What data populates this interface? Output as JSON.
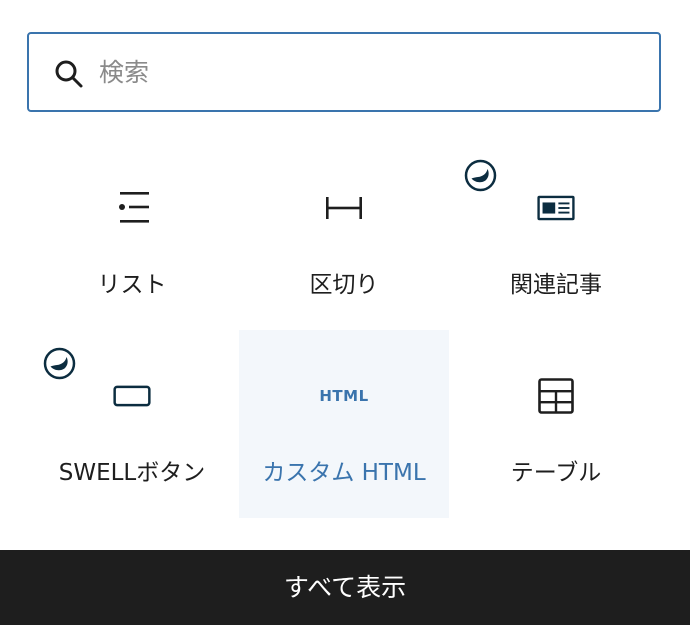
{
  "search": {
    "placeholder": "検索",
    "value": ""
  },
  "blocks": [
    {
      "label": "リスト",
      "icon": "list-icon",
      "badge": false,
      "active": false
    },
    {
      "label": "区切り",
      "icon": "separator-icon",
      "badge": false,
      "active": false
    },
    {
      "label": "関連記事",
      "icon": "post-card-icon",
      "badge": true,
      "active": false
    },
    {
      "label": "SWELLボタン",
      "icon": "button-icon",
      "badge": true,
      "active": false
    },
    {
      "label": "カスタム HTML",
      "icon": "html-icon",
      "icon_text": "HTML",
      "badge": false,
      "active": true
    },
    {
      "label": "テーブル",
      "icon": "table-icon",
      "badge": false,
      "active": false
    }
  ],
  "footer": {
    "label": "すべて表示"
  },
  "colors": {
    "accent": "#3a74ad",
    "badge": "#0c2d40",
    "footer_bg": "#1e1e1e",
    "active_bg": "#f3f7fb"
  }
}
